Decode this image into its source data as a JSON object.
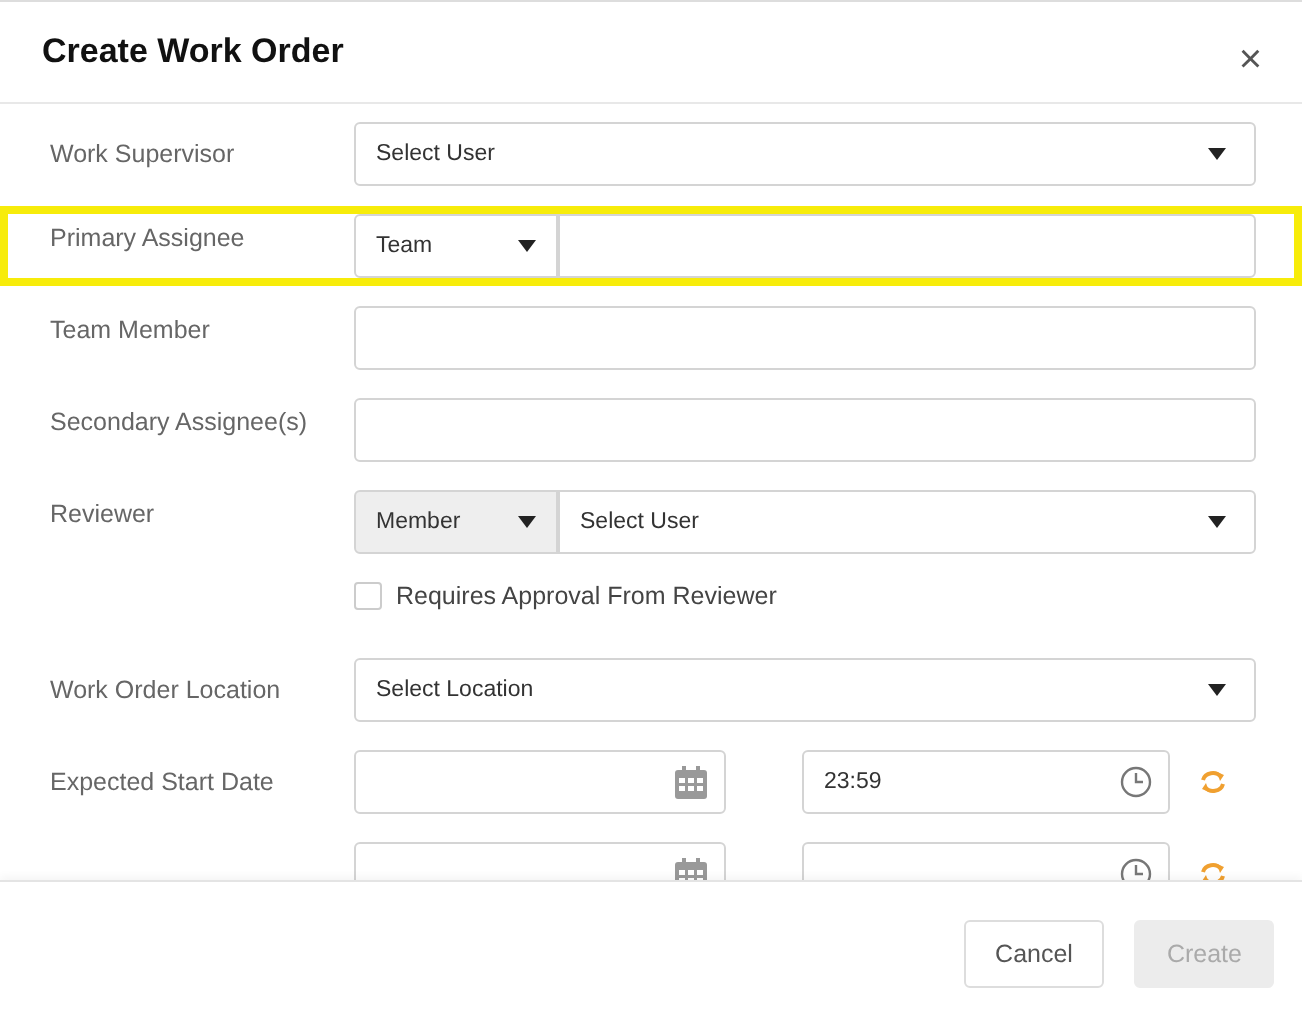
{
  "dialog": {
    "title": "Create Work Order",
    "close": "×"
  },
  "fields": [
    {
      "kind": "select",
      "label": "Work Supervisor",
      "highlighted": false,
      "placeholder": "Select User"
    },
    {
      "kind": "split",
      "label": "Primary Assignee",
      "highlighted": true,
      "type": {
        "value": "Team",
        "disabled": false
      }
    },
    {
      "kind": "text",
      "label": "Team Member",
      "highlighted": false
    },
    {
      "kind": "text",
      "label": "Secondary Assignee(s)",
      "highlighted": false
    },
    {
      "kind": "split",
      "label": "Reviewer",
      "highlighted": false,
      "type": {
        "value": "Member",
        "disabled": true
      },
      "placeholder": "Select User"
    },
    {
      "kind": "checkbox",
      "label": "Requires Approval From Reviewer",
      "highlighted": false,
      "checked": false
    },
    {
      "kind": "select",
      "label": "Work Order Location",
      "highlighted": false,
      "placeholder": "Select Location"
    },
    {
      "kind": "datetime",
      "label": "Expected Start Date",
      "highlighted": false,
      "time": "23:59"
    },
    {
      "kind": "datetime",
      "highlighted": false
    }
  ],
  "buttons": [
    {
      "label": "Cancel",
      "disabled": false
    },
    {
      "label": "Create",
      "disabled": true
    }
  ]
}
